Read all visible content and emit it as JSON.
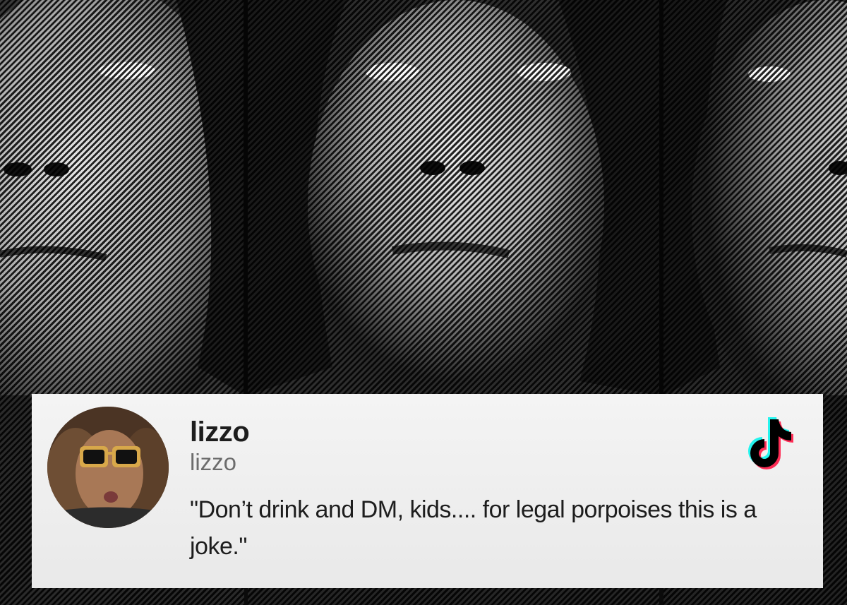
{
  "post": {
    "display_name": "lizzo",
    "handle": "lizzo",
    "text": "\"Don’t drink and DM, kids.... for legal porpoises this is a joke.\""
  },
  "icons": {
    "platform": "tiktok-logo-icon",
    "avatar": "profile-photo"
  },
  "colors": {
    "card_background": "#f0f0f0",
    "name_text": "#1d1d1d",
    "handle_text": "#6c6c6c",
    "tiktok_cyan": "#25f4ee",
    "tiktok_red": "#fe2c55",
    "tiktok_black": "#000000"
  }
}
